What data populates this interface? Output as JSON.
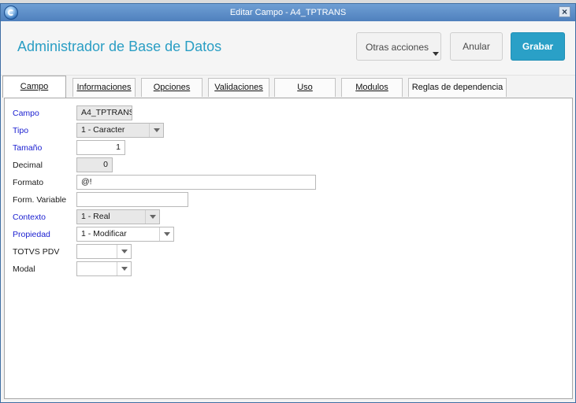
{
  "window": {
    "title": "Editar Campo - A4_TPTRANS",
    "close_symbol": "×"
  },
  "header": {
    "title": "Administrador de Base de Datos",
    "buttons": {
      "otras": "Otras acciones",
      "anular": "Anular",
      "grabar": "Grabar"
    }
  },
  "tabs": [
    {
      "label": "Campo",
      "active": true
    },
    {
      "label": "Informaciones",
      "active": false
    },
    {
      "label": "Opciones",
      "active": false
    },
    {
      "label": "Validaciones",
      "active": false
    },
    {
      "label": "Uso",
      "active": false
    },
    {
      "label": "Modulos",
      "active": false
    },
    {
      "label": "Reglas de dependencia",
      "active": false
    }
  ],
  "form": {
    "campo": {
      "label": "Campo",
      "value": "A4_TPTRANS"
    },
    "tipo": {
      "label": "Tipo",
      "value": "1 - Caracter"
    },
    "tamano": {
      "label": "Tamaño",
      "value": "1"
    },
    "decimal": {
      "label": "Decimal",
      "value": "0"
    },
    "formato": {
      "label": "Formato",
      "value": "@!"
    },
    "form_variable": {
      "label": "Form. Variable",
      "value": ""
    },
    "contexto": {
      "label": "Contexto",
      "value": "1 - Real"
    },
    "propiedad": {
      "label": "Propiedad",
      "value": "1 - Modificar"
    },
    "totvs_pdv": {
      "label": "TOTVS PDV",
      "value": ""
    },
    "modal": {
      "label": "Modal",
      "value": ""
    }
  },
  "colors": {
    "accent": "#2aa0c7",
    "required_label": "#1a1ed0",
    "titlebar": "#5a8bc6"
  }
}
